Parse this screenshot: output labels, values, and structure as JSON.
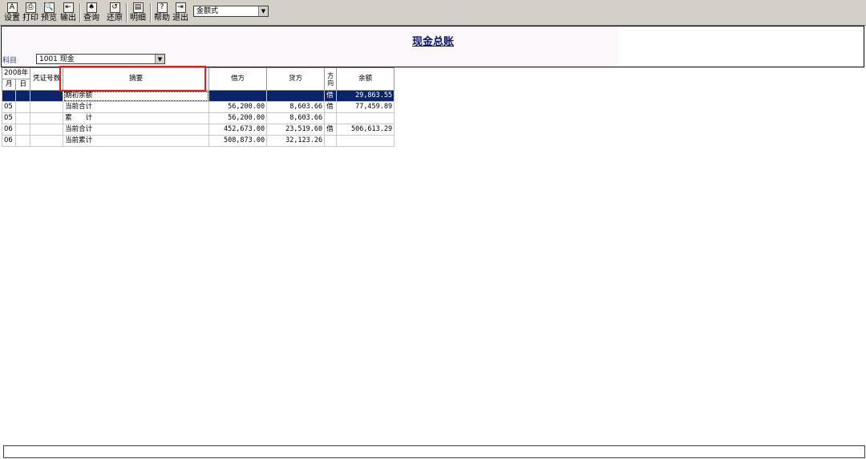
{
  "toolbar": {
    "buttons": [
      {
        "label": "设置",
        "icon": "A"
      },
      {
        "label": "打印",
        "icon": "⎙"
      },
      {
        "label": "预览",
        "icon": "🔍"
      },
      {
        "label": "输出",
        "icon": "⇤"
      },
      {
        "label": "查询",
        "icon": "♠"
      },
      {
        "label": "还原",
        "icon": "↺"
      },
      {
        "label": "明细",
        "icon": "▤"
      },
      {
        "label": "帮助",
        "icon": "?"
      },
      {
        "label": "退出",
        "icon": "⇥"
      }
    ],
    "format_select": "金额式"
  },
  "report": {
    "title": "现金总账",
    "subject_label": "科目",
    "subject_value": "1001 现金"
  },
  "table": {
    "year_header": "2008年",
    "month_header": "月",
    "day_header": "日",
    "voucher_header": "凭证号数",
    "summary_header": "摘要",
    "debit_header": "借方",
    "credit_header": "贷方",
    "direction_header": "方向",
    "balance_header": "余额",
    "rows": [
      {
        "month": "",
        "day": "",
        "voucher": "",
        "summary": "期初余额",
        "debit": "",
        "credit": "",
        "direction": "借",
        "balance": "29,863.55"
      },
      {
        "month": "05",
        "day": "",
        "voucher": "",
        "summary": "当前合计",
        "debit": "56,200.00",
        "credit": "8,603.66",
        "direction": "借",
        "balance": "77,459.89"
      },
      {
        "month": "05",
        "day": "",
        "voucher": "",
        "summary": "累　　计",
        "debit": "56,200.00",
        "credit": "8,603.66",
        "direction": "",
        "balance": ""
      },
      {
        "month": "06",
        "day": "",
        "voucher": "",
        "summary": "当前合计",
        "debit": "452,673.00",
        "credit": "23,519.60",
        "direction": "借",
        "balance": "506,613.29"
      },
      {
        "month": "06",
        "day": "",
        "voucher": "",
        "summary": "当前累计",
        "debit": "508,873.00",
        "credit": "32,123.26",
        "direction": "",
        "balance": ""
      }
    ]
  },
  "status_text": ""
}
